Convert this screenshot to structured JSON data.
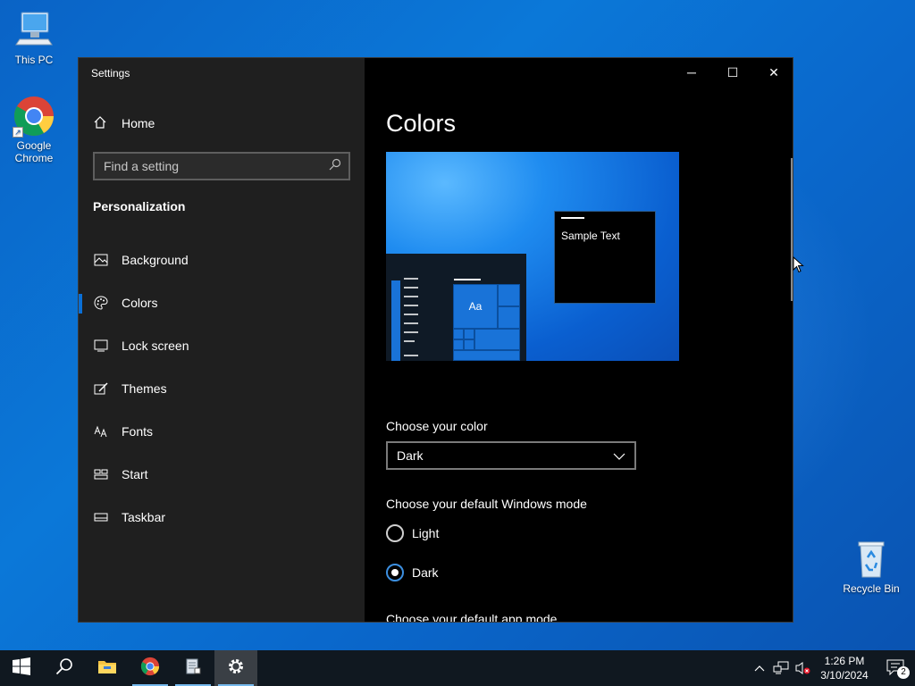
{
  "desktop": {
    "icons": [
      {
        "label": "This PC"
      },
      {
        "label": "Google Chrome"
      },
      {
        "label": "Recycle Bin"
      }
    ]
  },
  "window": {
    "title": "Settings",
    "controls": {
      "minimize": "─",
      "maximize": "☐",
      "close": "✕"
    }
  },
  "sidebar": {
    "home_label": "Home",
    "search_placeholder": "Find a setting",
    "section_title": "Personalization",
    "items": [
      {
        "label": "Background",
        "icon": "picture-icon",
        "active": false
      },
      {
        "label": "Colors",
        "icon": "palette-icon",
        "active": true
      },
      {
        "label": "Lock screen",
        "icon": "lock-screen-icon",
        "active": false
      },
      {
        "label": "Themes",
        "icon": "brush-icon",
        "active": false
      },
      {
        "label": "Fonts",
        "icon": "font-icon",
        "active": false
      },
      {
        "label": "Start",
        "icon": "start-grid-icon",
        "active": false
      },
      {
        "label": "Taskbar",
        "icon": "taskbar-icon",
        "active": false
      }
    ]
  },
  "main": {
    "page_title": "Colors",
    "preview": {
      "sample_text": "Sample Text",
      "tile_text": "Aa"
    },
    "choose_color": {
      "label": "Choose your color",
      "selected": "Dark"
    },
    "windows_mode": {
      "label": "Choose your default Windows mode",
      "options": [
        {
          "label": "Light",
          "checked": false
        },
        {
          "label": "Dark",
          "checked": true
        }
      ]
    },
    "app_mode_label": "Choose your default app mode"
  },
  "taskbar": {
    "clock_time": "1:26 PM",
    "clock_date": "3/10/2024",
    "notification_count": "2"
  },
  "colors": {
    "accent": "#0a6fd6",
    "sidebar_bg": "#1f1f1f",
    "content_bg": "#000000",
    "taskbar_bg": "#101820"
  }
}
